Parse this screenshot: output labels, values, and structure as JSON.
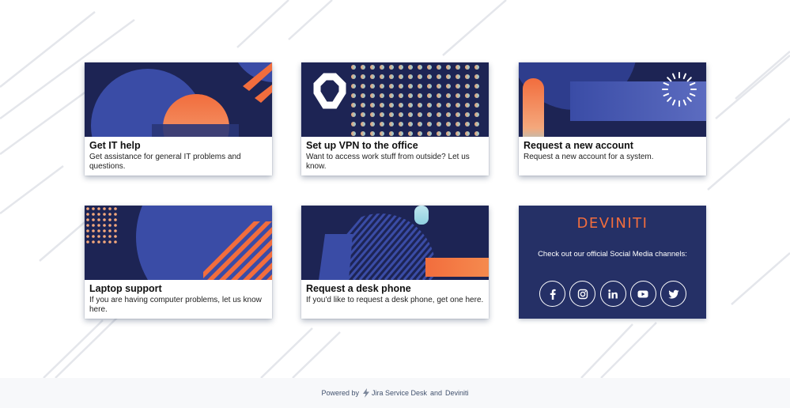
{
  "cards": [
    {
      "title": "Get IT help",
      "description": "Get assistance for general IT problems and questions."
    },
    {
      "title": "Set up VPN to the office",
      "description": "Want to access work stuff from outside? Let us know."
    },
    {
      "title": "Request a new account",
      "description": "Request a new account for a system."
    },
    {
      "title": "Laptop support",
      "description": "If you are having computer problems, let us know here."
    },
    {
      "title": "Request a desk phone",
      "description": "If you'd like to request a desk phone, get one here."
    }
  ],
  "social": {
    "logo_text": "DEVINITI",
    "text": "Check out our official Social Media channels:",
    "channels": [
      {
        "name": "Facebook",
        "icon": "facebook-icon"
      },
      {
        "name": "Instagram",
        "icon": "instagram-icon"
      },
      {
        "name": "LinkedIn",
        "icon": "linkedin-icon"
      },
      {
        "name": "YouTube",
        "icon": "youtube-icon"
      },
      {
        "name": "Twitter",
        "icon": "twitter-icon"
      }
    ]
  },
  "footer": {
    "powered_by": "Powered by",
    "product": "Jira Service Desk",
    "and": "and",
    "company": "Deviniti"
  },
  "colors": {
    "navy": "#253066",
    "dark_navy": "#1c2453",
    "blue": "#3b4fa8",
    "orange": "#f26d3d",
    "background_lines": "#e4e5ea"
  }
}
